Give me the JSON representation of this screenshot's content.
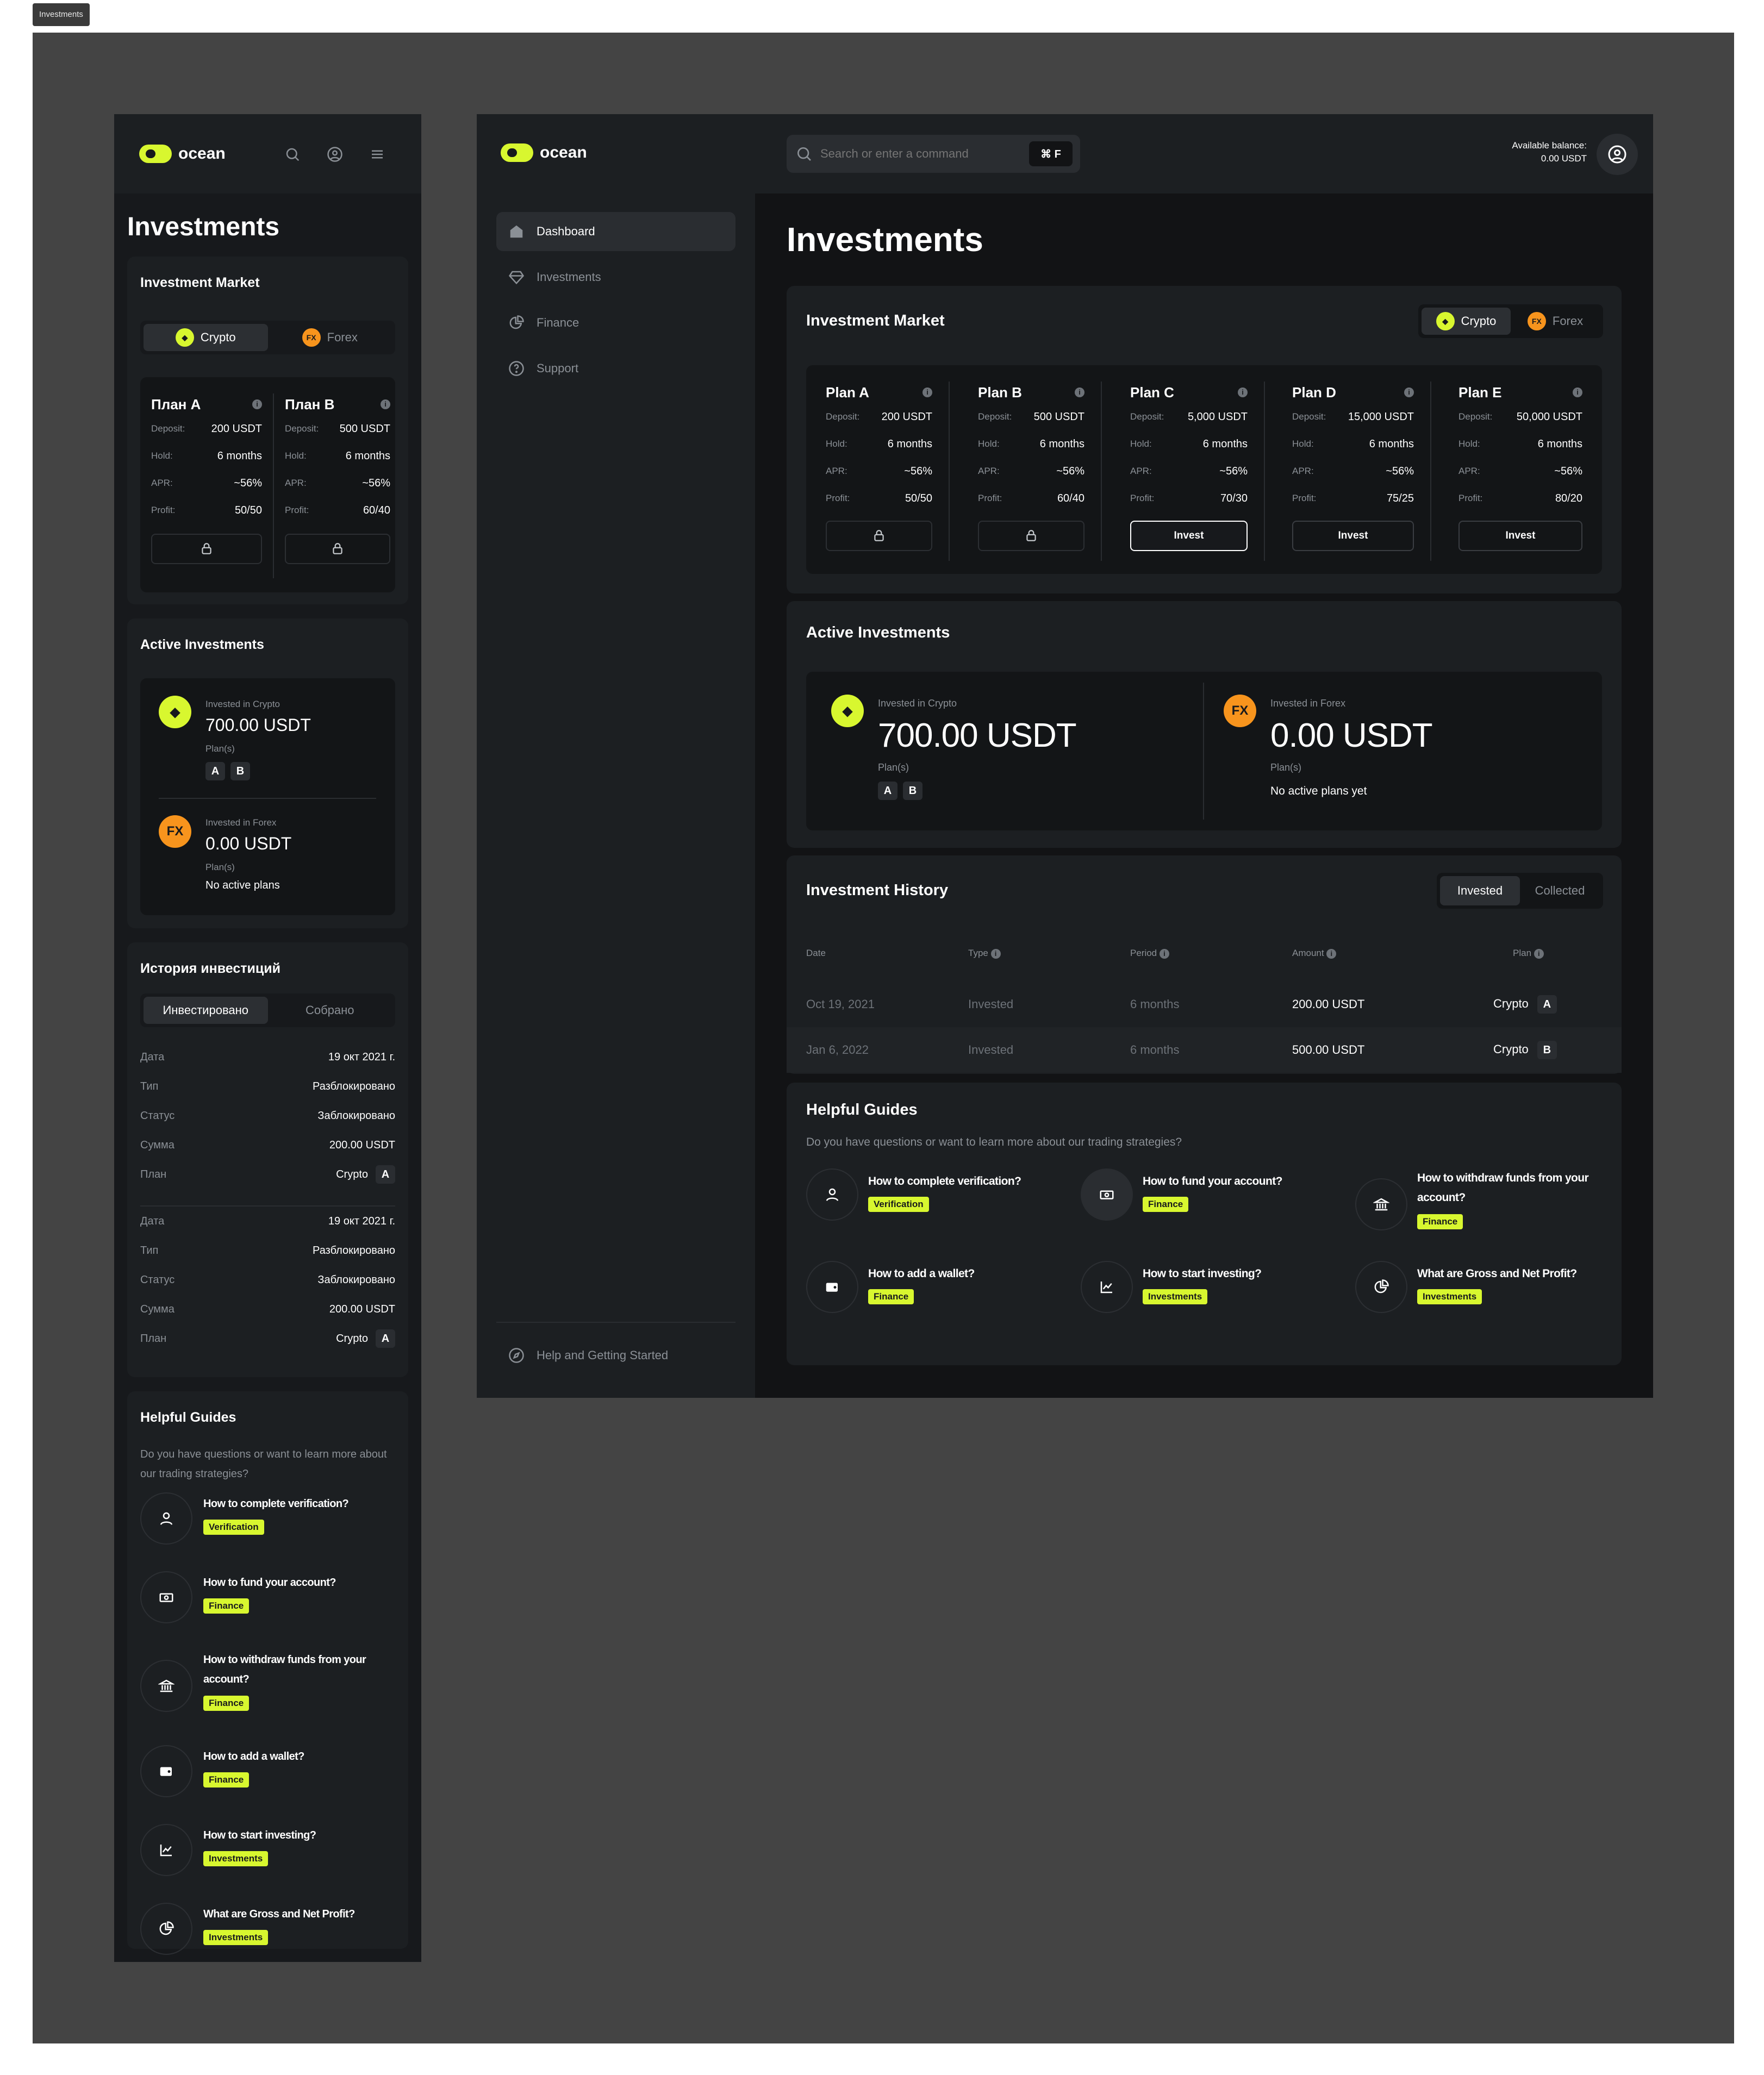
{
  "frame_label": "Investments",
  "brand": "ocean",
  "colors": {
    "accent": "#d8f72f",
    "forex": "#f7941d",
    "bg": "#121315",
    "card": "#1c1f22"
  },
  "mobile": {
    "title": "Investments",
    "market": {
      "title": "Investment Market",
      "tabs": [
        "Crypto",
        "Forex"
      ],
      "plans": [
        {
          "name": "План A",
          "deposit": "200 USDT",
          "hold": "6 months",
          "apr": "~56%",
          "profit": "50/50"
        },
        {
          "name": "План B",
          "deposit": "500 USDT",
          "hold": "6 months",
          "apr": "~56%",
          "profit": "60/40"
        }
      ]
    },
    "active": {
      "title": "Active Investments",
      "crypto_label": "Invested in Crypto",
      "crypto_amount": "700.00 USDT",
      "forex_label": "Invested in Forex",
      "forex_amount": "0.00 USDT",
      "plans_label": "Plan(s)",
      "no_plans": "No active plans",
      "plan_tags": [
        "A",
        "B"
      ]
    },
    "history": {
      "title": "История инвестиций",
      "tabs": [
        "Инвестировано",
        "Собрано"
      ],
      "entries": [
        {
          "date_k": "Дата",
          "date": "19 окт 2021 г.",
          "type_k": "Тип",
          "type": "Разблокировано",
          "status_k": "Статус",
          "status": "Заблокировано",
          "sum_k": "Сумма",
          "sum": "200.00 USDT",
          "plan_k": "План",
          "plan": "Crypto",
          "plan_tag": "A"
        },
        {
          "date_k": "Дата",
          "date": "19 окт 2021 г.",
          "type_k": "Тип",
          "type": "Разблокировано",
          "status_k": "Статус",
          "status": "Заблокировано",
          "sum_k": "Сумма",
          "sum": "200.00 USDT",
          "plan_k": "План",
          "plan": "Crypto",
          "plan_tag": "A"
        }
      ]
    },
    "guides": {
      "title": "Helpful Guides",
      "subtitle": "Do you have questions or want to learn more about our trading strategies?"
    }
  },
  "labels": {
    "deposit": "Deposit:",
    "hold": "Hold:",
    "apr": "APR:",
    "profit": "Profit:"
  },
  "desktop": {
    "nav": [
      {
        "label": "Dashboard",
        "icon": "home-icon"
      },
      {
        "label": "Investments",
        "icon": "diamond-icon"
      },
      {
        "label": "Finance",
        "icon": "pie-chart-icon"
      },
      {
        "label": "Support",
        "icon": "help-icon"
      }
    ],
    "help_link": "Help and Getting Started",
    "search": {
      "placeholder": "Search or enter a command",
      "shortcut": "⌘ F"
    },
    "balance_label": "Available balance:",
    "balance_value": "0.00 USDT",
    "title": "Investments",
    "market": {
      "title": "Investment Market",
      "tabs": [
        "Crypto",
        "Forex"
      ],
      "invest_label": "Invest",
      "plans": [
        {
          "name": "Plan A",
          "deposit": "200 USDT",
          "hold": "6 months",
          "apr": "~56%",
          "profit": "50/50",
          "locked": true
        },
        {
          "name": "Plan B",
          "deposit": "500 USDT",
          "hold": "6 months",
          "apr": "~56%",
          "profit": "60/40",
          "locked": true
        },
        {
          "name": "Plan C",
          "deposit": "5,000 USDT",
          "hold": "6 months",
          "apr": "~56%",
          "profit": "70/30",
          "locked": false
        },
        {
          "name": "Plan D",
          "deposit": "15,000 USDT",
          "hold": "6 months",
          "apr": "~56%",
          "profit": "75/25",
          "locked": false
        },
        {
          "name": "Plan E",
          "deposit": "50,000 USDT",
          "hold": "6 months",
          "apr": "~56%",
          "profit": "80/20",
          "locked": false
        }
      ]
    },
    "active": {
      "title": "Active Investments",
      "crypto_label": "Invested in Crypto",
      "crypto_amount": "700.00 USDT",
      "forex_label": "Invested in Forex",
      "forex_amount": "0.00 USDT",
      "plans_label": "Plan(s)",
      "no_plans": "No active plans yet",
      "plan_tags": [
        "A",
        "B"
      ]
    },
    "history": {
      "title": "Investment History",
      "tabs": [
        "Invested",
        "Collected"
      ],
      "columns": [
        "Date",
        "Type",
        "Period",
        "Amount",
        "Plan"
      ],
      "rows": [
        {
          "date": "Oct 19, 2021",
          "type": "Invested",
          "period": "6 months",
          "amount": "200.00 USDT",
          "plan": "Crypto",
          "tag": "A"
        },
        {
          "date": "Jan 6, 2022",
          "type": "Invested",
          "period": "6 months",
          "amount": "500.00 USDT",
          "plan": "Crypto",
          "tag": "B"
        }
      ]
    },
    "guides": {
      "title": "Helpful Guides",
      "subtitle": "Do you have questions or want to learn more about our trading strategies?",
      "items": [
        {
          "title": "How to complete verification?",
          "tag": "Verification",
          "icon": "user-icon"
        },
        {
          "title": "How to fund your account?",
          "tag": "Finance",
          "icon": "money-icon"
        },
        {
          "title": "How to withdraw funds from your account?",
          "tag": "Finance",
          "icon": "bank-icon"
        },
        {
          "title": "How to add a wallet?",
          "tag": "Finance",
          "icon": "wallet-icon"
        },
        {
          "title": "How to start investing?",
          "tag": "Investments",
          "icon": "chart-icon"
        },
        {
          "title": "What are Gross and Net Profit?",
          "tag": "Investments",
          "icon": "pie-chart-icon"
        }
      ]
    }
  }
}
